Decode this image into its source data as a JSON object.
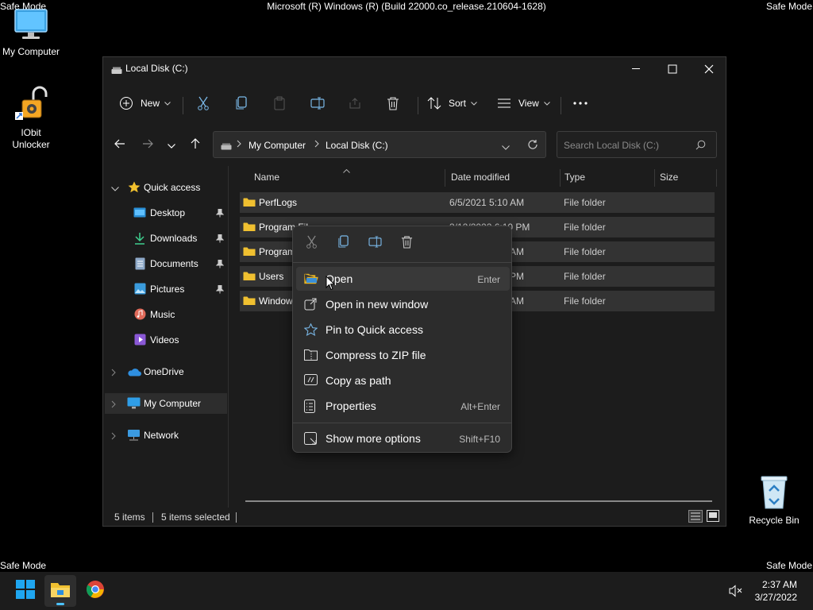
{
  "desktop": {
    "safe_mode_label": "Safe Mode",
    "build_text": "Microsoft (R) Windows (R) (Build 22000.co_release.210604-1628)",
    "icons": [
      {
        "label": "My Computer",
        "icon": "monitor-icon"
      },
      {
        "label": "IObit Unlocker",
        "icon": "unlocker-icon"
      },
      {
        "label": "Recycle Bin",
        "icon": "recycle-bin-icon"
      }
    ]
  },
  "window": {
    "title": "Local Disk (C:)",
    "toolbar": {
      "new_label": "New",
      "sort_label": "Sort",
      "view_label": "View"
    },
    "address": {
      "segments": [
        "My Computer",
        "Local Disk (C:)"
      ]
    },
    "search_placeholder": "Search Local Disk (C:)",
    "nav": {
      "quick_access": "Quick access",
      "pinned": [
        {
          "label": "Desktop",
          "pinned": true
        },
        {
          "label": "Downloads",
          "pinned": true
        },
        {
          "label": "Documents",
          "pinned": true
        },
        {
          "label": "Pictures",
          "pinned": true
        },
        {
          "label": "Music",
          "pinned": false
        },
        {
          "label": "Videos",
          "pinned": false
        }
      ],
      "onedrive": "OneDrive",
      "my_computer": "My Computer",
      "network": "Network"
    },
    "columns": {
      "name": "Name",
      "date": "Date modified",
      "type": "Type",
      "size": "Size"
    },
    "files": [
      {
        "name": "PerfLogs",
        "date": "6/5/2021 5:10 AM",
        "type": "File folder"
      },
      {
        "name": "Program Fil",
        "date": "3/12/2022 6:10 PM",
        "type": "File folder"
      },
      {
        "name": "Program",
        "date": "AM",
        "type": "File folder"
      },
      {
        "name": "Users",
        "date": "PM",
        "type": "File folder"
      },
      {
        "name": "Window",
        "date": "AM",
        "type": "File folder"
      }
    ],
    "status": {
      "count": "5 items",
      "selected": "5 items selected"
    }
  },
  "context_menu": {
    "items": [
      {
        "label": "Open",
        "shortcut": "Enter"
      },
      {
        "label": "Open in new window",
        "shortcut": ""
      },
      {
        "label": "Pin to Quick access",
        "shortcut": ""
      },
      {
        "label": "Compress to ZIP file",
        "shortcut": ""
      },
      {
        "label": "Copy as path",
        "shortcut": ""
      },
      {
        "label": "Properties",
        "shortcut": "Alt+Enter"
      },
      {
        "label": "Show more options",
        "shortcut": "Shift+F10"
      }
    ]
  },
  "taskbar": {
    "time": "2:37 AM",
    "date": "3/27/2022"
  },
  "colors": {
    "folder": "#f0c030",
    "accent": "#4cc2ff",
    "selected_row": "#333333"
  }
}
